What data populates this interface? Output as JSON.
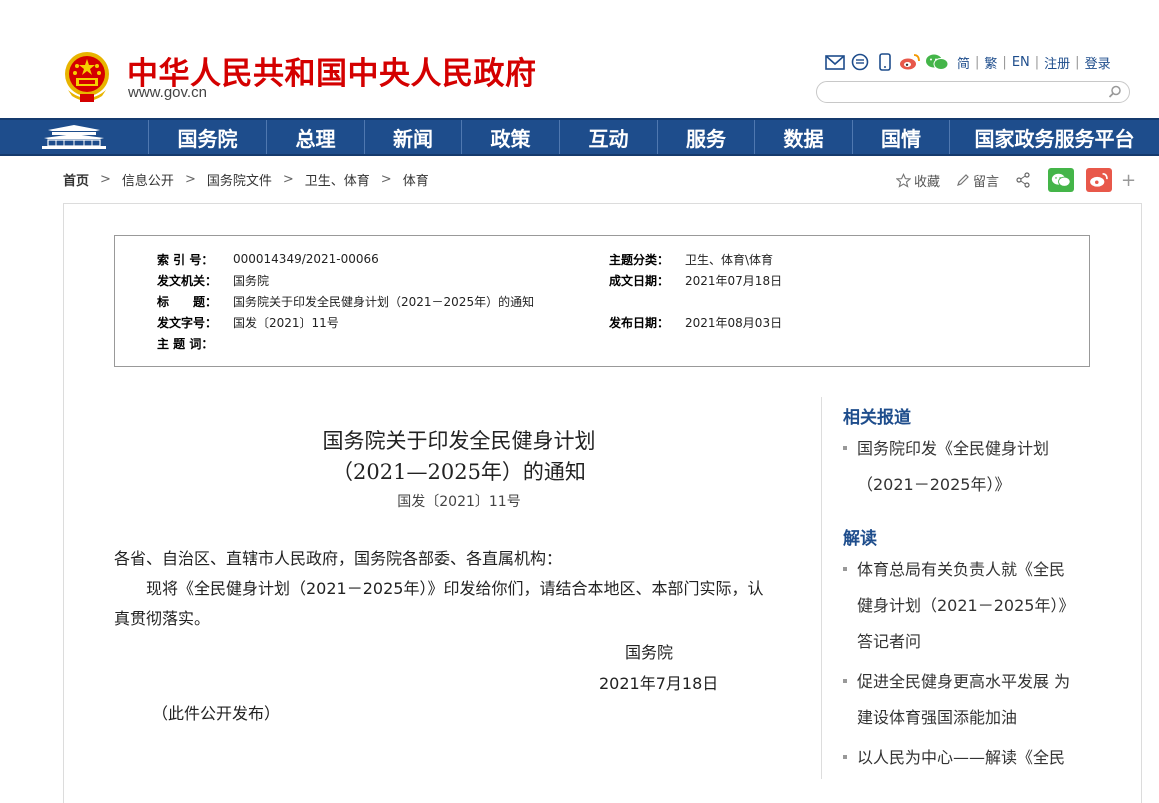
{
  "header": {
    "site_title": "中华人民共和国中央人民政府",
    "site_domain": "www.gov.cn",
    "tool_links": [
      "简",
      "繁",
      "EN",
      "注册",
      "登录"
    ],
    "icons": [
      "mail-icon",
      "message-icon",
      "mobile-icon",
      "weibo-icon",
      "wechat-icon"
    ]
  },
  "nav": {
    "items": [
      "国务院",
      "总理",
      "新闻",
      "政策",
      "互动",
      "服务",
      "数据",
      "国情",
      "国家政务服务平台"
    ]
  },
  "breadcrumb": [
    "首页",
    "信息公开",
    "国务院文件",
    "卫生、体育",
    "体育"
  ],
  "share": {
    "collect": "收藏",
    "comment": "留言"
  },
  "meta": {
    "index_label": "索 引 号：",
    "index_value": "000014349/2021-00066",
    "topic_label": "主题分类：",
    "topic_value": "卫生、体育\\体育",
    "issuer_label": "发文机关：",
    "issuer_value": "国务院",
    "date_made_label": "成文日期：",
    "date_made_value": "2021年07月18日",
    "title_label": "标　　题：",
    "title_value": "国务院关于印发全民健身计划（2021－2025年）的通知",
    "docno_label": "发文字号：",
    "docno_value": "国发〔2021〕11号",
    "pub_label": "发布日期：",
    "pub_value": "2021年08月03日",
    "keywords_label": "主 题 词："
  },
  "article": {
    "title_line1": "国务院关于印发全民健身计划",
    "title_line2": "（2021—2025年）的通知",
    "doc_number": "国发〔2021〕11号",
    "salutation": "各省、自治区、直辖市人民政府，国务院各部委、各直属机构：",
    "body_line1": "　　现将《全民健身计划（2021－2025年）》印发给你们，请结合本地区、本部门实际，认",
    "body_line2": "真贯彻落实。",
    "signature": "国务院",
    "sign_date": "2021年7月18日",
    "public_note": "（此件公开发布）"
  },
  "sidebar": {
    "related_heading": "相关报道",
    "related_items": [
      {
        "line1": "国务院印发《全民健身计划",
        "line2": "（2021－2025年）》"
      }
    ],
    "interpret_heading": "解读",
    "interpret_items": [
      {
        "line1": "体育总局有关负责人就《全民",
        "line2": "健身计划（2021－2025年）》",
        "line3": "答记者问"
      },
      {
        "line1": "促进全民健身更高水平发展 为",
        "line2": "建设体育强国添能加油"
      },
      {
        "line1": "以人民为中心——解读《全民"
      }
    ]
  },
  "colors": {
    "brand_red": "#d40000",
    "nav_blue": "#1e4d8c",
    "wechat_green": "#44b549",
    "weibo_red": "#e8584a"
  }
}
